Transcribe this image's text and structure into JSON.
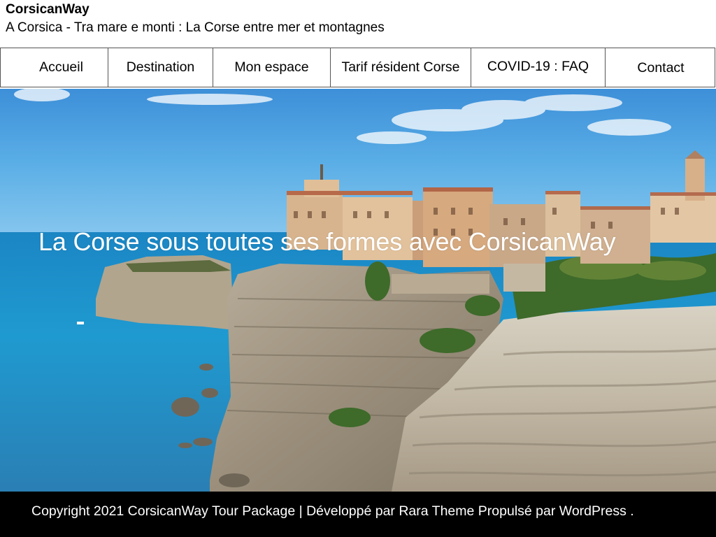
{
  "header": {
    "site_title": "CorsicanWay",
    "tagline": "A Corsica - Tra mare e monti : La Corse entre mer et montagnes"
  },
  "nav": {
    "items": [
      {
        "label": "Accueil"
      },
      {
        "label": "Destination"
      },
      {
        "label": "Mon espace"
      },
      {
        "label": "Tarif résident Corse"
      },
      {
        "label": "COVID-19 : FAQ"
      },
      {
        "label": "Contact"
      }
    ]
  },
  "hero": {
    "heading": "La Corse sous toutes ses formes avec CorsicanWay",
    "image_subject": "Bonifacio cliffs and old town above the sea"
  },
  "footer": {
    "text": "Copyright 2021 CorsicanWay Tour Package | Développé par Rara Theme Propulsé par WordPress ."
  },
  "colors": {
    "footer_bg": "#000000",
    "nav_border": "#555555",
    "sky": "#4fa3e0",
    "sea": "#1f8fc8"
  }
}
